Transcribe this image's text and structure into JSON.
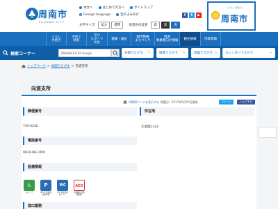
{
  "header": {
    "logo": {
      "title": "周南市",
      "subtitle": "SHUNAN CITY"
    },
    "util_links": [
      "本文へ",
      "はじめての方へ",
      "サイトマップ"
    ],
    "util_links2": [
      "Foreign language",
      "音声よみあげ"
    ],
    "font_size_label": "文字サイズ",
    "font_size_buttons": [
      "拡大",
      "標準"
    ],
    "bg_color_label": "背景色の変更",
    "bg_color_buttons": [
      "白",
      "黒",
      "青"
    ],
    "social": [
      {
        "icon": "facebook-icon",
        "glyph": "f"
      },
      {
        "icon": "twitter-icon",
        "glyph": "t"
      },
      {
        "icon": "youtube-icon",
        "glyph": "▶"
      }
    ],
    "mascot": {
      "title": "周南市",
      "small": "こちら！周南のう"
    }
  },
  "nav": {
    "items": [
      {
        "label": "くらし\n手続き"
      },
      {
        "label": "子育て\n教育"
      },
      {
        "label": "学び\nスポーツ\n文化"
      },
      {
        "label": "健康・福祉"
      },
      {
        "label": "都市整備\nまちづくり"
      },
      {
        "label": "周南\n事業者向け情報"
      },
      {
        "label": "観光情報"
      },
      {
        "label": "市政情報"
      }
    ]
  },
  "search": {
    "label": "検索コーナー",
    "placeholder": "ENHANCED BY Google",
    "dropdowns": [
      "分類でさがす",
      "組織でさがす",
      "地図でさがす",
      "カレンダーでさがす"
    ]
  },
  "breadcrumb": {
    "items": [
      "トップページ",
      "地図でさがす",
      "向道支所"
    ]
  },
  "content": {
    "title": "向道支所",
    "print_label": "印刷用ページを表示する",
    "published": "掲載日：2017年5月10日更新",
    "share_tweet": "ツイート",
    "share_fb": "シェアする",
    "sections": {
      "postal": {
        "heading": "郵便番号",
        "value": "745-0242"
      },
      "address": {
        "heading": "所在地",
        "value": "大道理1332"
      },
      "phone": {
        "heading": "電話番号",
        "value": "0834-88-1000"
      },
      "facilities": {
        "heading": "設備情報"
      },
      "services": {
        "heading": "窓口業務"
      }
    },
    "facility_items": [
      {
        "icon": "slope-icon",
        "glyph": "♿",
        "caption": "スロープ"
      },
      {
        "icon": "wheelchair-parking-icon",
        "glyph": "P",
        "caption": "車いす使用者用駐車場"
      },
      {
        "icon": "accessible-toilet-icon",
        "glyph": "WC",
        "caption": "車いす使用者用トイレ"
      },
      {
        "icon": "aed-icon",
        "glyph": "AED",
        "caption": "自動体外式除細動器"
      }
    ]
  },
  "colors": {
    "primary": "#1a6fbf",
    "nav_dark": "#0f4f8f",
    "search_bar": "#0e5fa8",
    "background": "#f3f5f7"
  }
}
